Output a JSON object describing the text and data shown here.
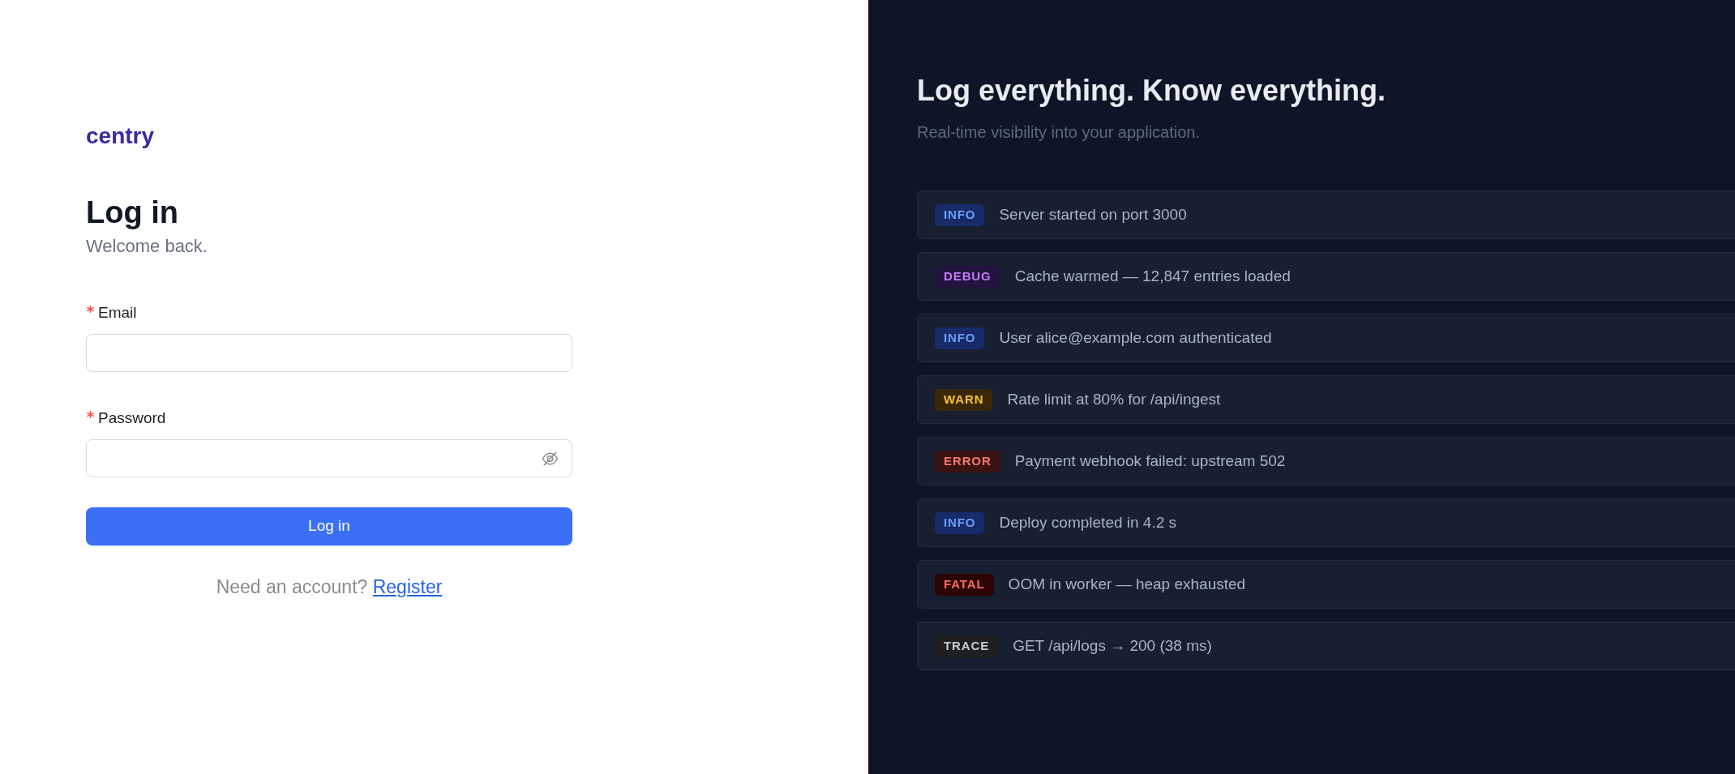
{
  "brand": {
    "logo": "centry"
  },
  "login": {
    "title": "Log in",
    "subtitle": "Welcome back.",
    "fields": [
      {
        "label": "Email",
        "required": true,
        "kind": "text"
      },
      {
        "label": "Password",
        "required": true,
        "kind": "password"
      }
    ],
    "submit_button": "Log in",
    "footer": {
      "prompt": "Need an account?",
      "link": "Register"
    }
  },
  "hero": {
    "title": "Log everything. Know everything.",
    "subtitle": "Real-time visibility into your application.",
    "log_entries": [
      {
        "tag": "INFO",
        "kind": "info",
        "message": "Server started on port 3000"
      },
      {
        "tag": "DEBUG",
        "kind": "debug",
        "message": "Cache warmed — 12,847 entries loaded"
      },
      {
        "tag": "INFO",
        "kind": "info",
        "message": "User alice@example.com authenticated"
      },
      {
        "tag": "WARN",
        "kind": "warn",
        "message": "Rate limit at 80% for /api/ingest"
      },
      {
        "tag": "ERROR",
        "kind": "error",
        "message": "Payment webhook failed: upstream 502"
      },
      {
        "tag": "INFO",
        "kind": "info",
        "message": "Deploy completed in 4.2 s"
      },
      {
        "tag": "FATAL",
        "kind": "fatal",
        "message": "OOM in worker — heap exhausted"
      },
      {
        "tag": "TRACE",
        "kind": "trace",
        "message": "GET /api/logs → 200 (38 ms)"
      }
    ]
  }
}
